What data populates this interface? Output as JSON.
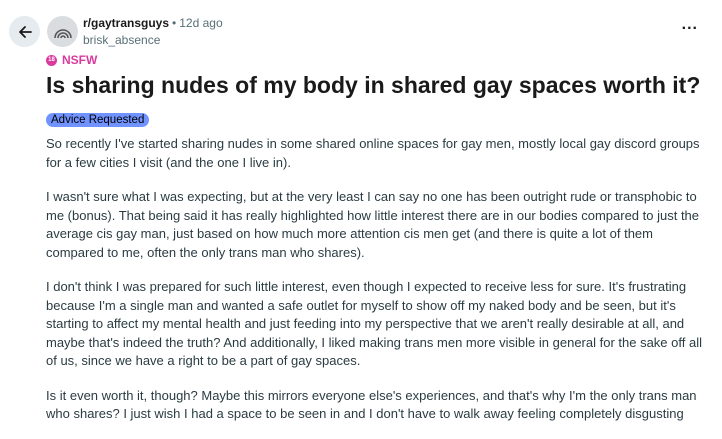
{
  "header": {
    "subreddit": "r/gaytransguys",
    "separator": "•",
    "age": "12d ago",
    "author": "brisk_absence"
  },
  "badge": {
    "nsfw_icon_text": "18",
    "nsfw_label": "NSFW"
  },
  "post": {
    "title": "Is sharing nudes of my body in shared gay spaces worth it?",
    "flair": "Advice Requested",
    "paragraphs": [
      "So recently I've started sharing nudes in some shared online spaces for gay men, mostly local gay discord groups for a few cities I visit (and the one I live in).",
      "I wasn't sure what I was expecting, but at the very least I can say no one has been outright rude or transphobic to me (bonus). That being said it has really highlighted how little interest there are in our bodies compared to just the average cis gay man, just based on how much more attention cis men get (and there is quite a lot of them compared to me, often the only trans man who shares).",
      "I don't think I was prepared for such little interest, even though I expected to receive less for sure. It's frustrating because I'm a single man and wanted a safe outlet for myself to show off my naked body and be seen, but it's starting to affect my mental health and just feeding into my perspective that we aren't really desirable at all, and maybe that's indeed the truth? And additionally, I liked making trans men more visible in general for the sake off all of us, since we have a right to be a part of gay spaces.",
      "Is it even worth it, though? Maybe this mirrors everyone else's experiences, and that's why I'm the only trans man who shares? I just wish I had a space to be seen in and I don't have to walk away feeling completely disgusting"
    ]
  },
  "actions": {
    "more_label": "..."
  },
  "icons": {
    "back": "arrow-left-icon",
    "avatar": "subreddit-avatar-icon",
    "nsfw": "nsfw-18-icon"
  },
  "colors": {
    "nsfw": "#d93a9e",
    "flair_bg": "#7193ff",
    "back_bg": "#e5ebee",
    "meta_text": "#576f76",
    "body_text": "#2a3c42"
  }
}
